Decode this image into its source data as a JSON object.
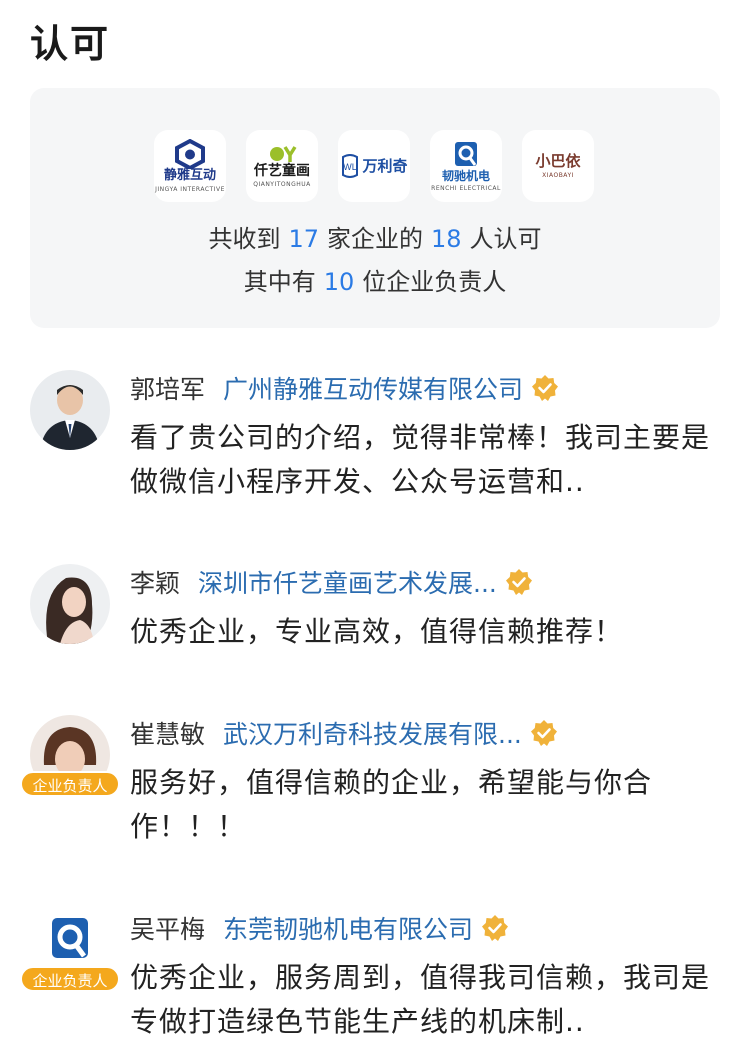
{
  "header": {
    "title": "认可"
  },
  "summary": {
    "logos": [
      {
        "name": "静雅互动",
        "sub": "JINGYA INTERACTIVE",
        "color": "#1f3a8a"
      },
      {
        "name": "仟艺童画",
        "sub": "QIANYITONGHUA",
        "color": "#1a1a1a"
      },
      {
        "name": "万利奇",
        "sub": "",
        "color": "#1e4fa3"
      },
      {
        "name": "韧驰机电",
        "sub": "RENCHI ELECTRICAL",
        "color": "#1d5fb0"
      },
      {
        "name": "小巴依",
        "sub": "XIAOBAYI",
        "color": "#7a3b2e"
      }
    ],
    "line1": {
      "prefix": "共收到",
      "company_count": "17",
      "middle": "家企业的",
      "people_count": "18",
      "suffix": "人认可"
    },
    "line2": {
      "prefix": "其中有",
      "leader_count": "10",
      "suffix": "位企业负责人"
    }
  },
  "comments": [
    {
      "name": "郭培军",
      "company": "广州静雅互动传媒有限公司",
      "text": "看了贵公司的介绍，觉得非常棒！我司主要是做微信小程序开发、公众号运营和..",
      "badge": "",
      "verified": true
    },
    {
      "name": "李颖",
      "company": "深圳市仟艺童画艺术发展...",
      "text": "优秀企业，专业高效，值得信赖推荐！",
      "badge": "",
      "verified": true
    },
    {
      "name": "崔慧敏",
      "company": "武汉万利奇科技发展有限...",
      "text": "服务好，值得信赖的企业，希望能与你合作！！！",
      "badge": "企业负责人",
      "verified": true
    },
    {
      "name": "吴平梅",
      "company": "东莞韧驰机电有限公司",
      "text": "优秀企业，服务周到，值得我司信赖，我司是专做打造绿色节能生产线的机床制..",
      "badge": "企业负责人",
      "verified": true
    }
  ],
  "colors": {
    "accent": "#2b7be5",
    "link": "#2b6cb0",
    "badge": "#f4a81d",
    "verified": "#f0b23a",
    "card_bg": "#f5f6f7"
  },
  "icons": {
    "verified": "verified-check-icon"
  }
}
